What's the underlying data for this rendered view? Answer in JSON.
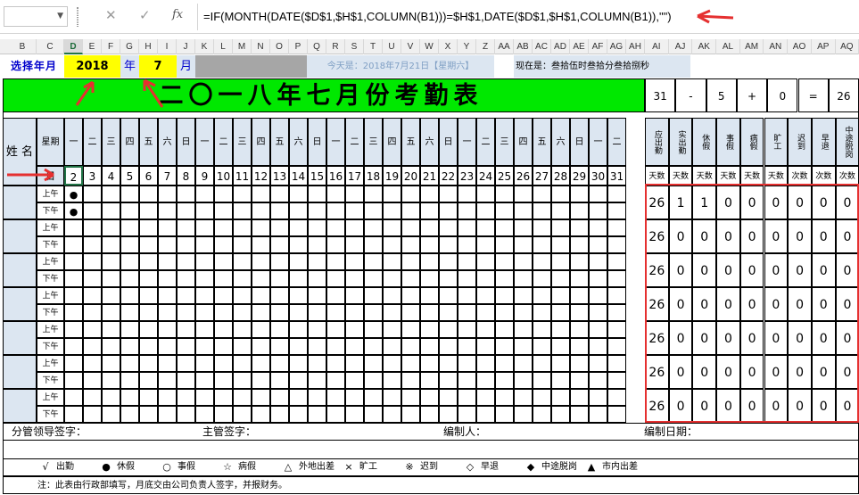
{
  "formula_bar": {
    "name_box": "",
    "cancel_icon": "✕",
    "enter_icon": "✓",
    "fx_label": "fx",
    "formula": "=IF(MONTH(DATE($D$1,$H$1,COLUMN(B1)))=$H$1,DATE($D$1,$H$1,COLUMN(B1)),\"\")"
  },
  "columns": [
    "B",
    "C",
    "D",
    "E",
    "F",
    "G",
    "H",
    "I",
    "J",
    "K",
    "L",
    "M",
    "N",
    "O",
    "P",
    "Q",
    "R",
    "S",
    "T",
    "U",
    "V",
    "W",
    "X",
    "Y",
    "Z",
    "AA",
    "AB",
    "AC",
    "AD",
    "AE",
    "AF",
    "AG",
    "AH",
    "AI",
    "AJ",
    "AK",
    "AL",
    "AM",
    "AN",
    "AO",
    "AP",
    "AQ"
  ],
  "selected_column": "D",
  "top": {
    "select_label": "选择年月",
    "year": "2018",
    "year_unit": "年",
    "month": "7",
    "month_unit": "月",
    "today": "今天是：2018年7月21日【星期六】",
    "now": "现在是：叁拾伍时叁拾分叁拾捌秒"
  },
  "title": "二〇一八年七月份考勤表",
  "summary_calc": [
    "31",
    "-",
    "5",
    "+",
    "0",
    "=",
    "26"
  ],
  "header": {
    "name_label": "姓 名",
    "week_label": "星期",
    "date_label": "日",
    "weekdays": [
      "一",
      "二",
      "三",
      "四",
      "五",
      "六",
      "日",
      "一",
      "二",
      "三",
      "四",
      "五",
      "六",
      "日",
      "一",
      "二",
      "三",
      "四",
      "五",
      "六",
      "日",
      "一",
      "二",
      "三",
      "四",
      "五",
      "六",
      "日",
      "一",
      "二"
    ],
    "dates": [
      "2",
      "3",
      "4",
      "5",
      "6",
      "7",
      "8",
      "9",
      "10",
      "11",
      "12",
      "13",
      "14",
      "15",
      "16",
      "17",
      "18",
      "19",
      "20",
      "21",
      "22",
      "23",
      "24",
      "25",
      "26",
      "27",
      "28",
      "29",
      "30",
      "31"
    ]
  },
  "stat_headers": [
    "应出勤",
    "实出勤",
    "休假",
    "事假",
    "病假",
    "旷工",
    "迟到",
    "早退",
    "中途脱岗"
  ],
  "stat_units": [
    "天数",
    "天数",
    "天数",
    "天数",
    "天数",
    "天数",
    "次数",
    "次数",
    "次数"
  ],
  "am": "上午",
  "pm": "下午",
  "rows": [
    {
      "stats": [
        "26",
        "1",
        "1",
        "0",
        "0",
        "0",
        "0",
        "0",
        "0"
      ],
      "am_mark": "●",
      "pm_mark": "●"
    },
    {
      "stats": [
        "26",
        "0",
        "0",
        "0",
        "0",
        "0",
        "0",
        "0",
        "0"
      ],
      "am_mark": "",
      "pm_mark": ""
    },
    {
      "stats": [
        "26",
        "0",
        "0",
        "0",
        "0",
        "0",
        "0",
        "0",
        "0"
      ],
      "am_mark": "",
      "pm_mark": ""
    },
    {
      "stats": [
        "26",
        "0",
        "0",
        "0",
        "0",
        "0",
        "0",
        "0",
        "0"
      ],
      "am_mark": "",
      "pm_mark": ""
    },
    {
      "stats": [
        "26",
        "0",
        "0",
        "0",
        "0",
        "0",
        "0",
        "0",
        "0"
      ],
      "am_mark": "",
      "pm_mark": ""
    },
    {
      "stats": [
        "26",
        "0",
        "0",
        "0",
        "0",
        "0",
        "0",
        "0",
        "0"
      ],
      "am_mark": "",
      "pm_mark": ""
    },
    {
      "stats": [
        "26",
        "0",
        "0",
        "0",
        "0",
        "0",
        "0",
        "0",
        "0"
      ],
      "am_mark": "",
      "pm_mark": ""
    }
  ],
  "footer": {
    "sign1": "分管领导签字：",
    "sign2": "主管签字：",
    "sign3": "编制人：",
    "sign4": "编制日期："
  },
  "legend": [
    [
      "√",
      "出勤"
    ],
    [
      "●",
      "休假"
    ],
    [
      "○",
      "事假"
    ],
    [
      "☆",
      "病假"
    ],
    [
      "△",
      "外地出差"
    ],
    [
      "×",
      "旷工"
    ],
    [
      "※",
      "迟到"
    ],
    [
      "◇",
      "早退"
    ],
    [
      "◆",
      "中途脱岗"
    ],
    [
      "▲",
      "市内出差"
    ]
  ],
  "note": "注：此表由行政部填写，月底交由公司负责人签字，并报财务。"
}
